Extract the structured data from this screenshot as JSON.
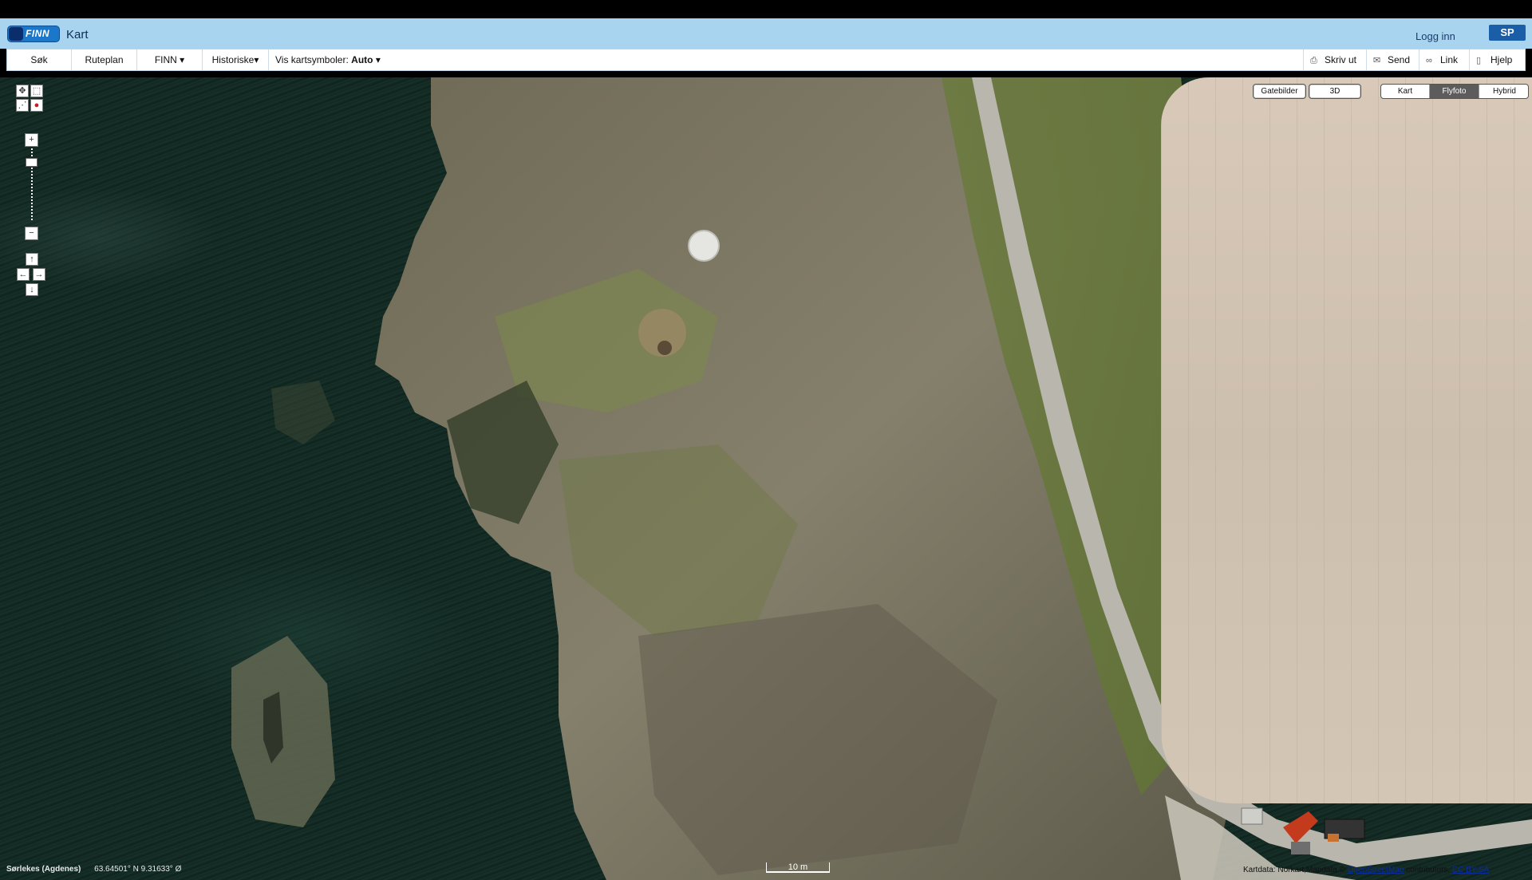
{
  "header": {
    "logo_text": "FINN",
    "app_title": "Kart",
    "login_label": "Logg inn",
    "brand_badge": "SP"
  },
  "toolbar": {
    "items": [
      {
        "label": "Søk"
      },
      {
        "label": "Ruteplan"
      },
      {
        "label": "FINN ▾"
      },
      {
        "label": "Historiske▾"
      }
    ],
    "symbols_prefix": "Vis kartsymboler:",
    "symbols_value": "Auto ▾",
    "actions": [
      {
        "label": "Skriv ut",
        "icon": "printer-icon"
      },
      {
        "label": "Send",
        "icon": "mail-icon"
      },
      {
        "label": "Link",
        "icon": "link-icon"
      },
      {
        "label": "Hjelp",
        "icon": "help-icon"
      }
    ]
  },
  "map": {
    "view_buttons": [
      "Gatebilder",
      "3D"
    ],
    "map_types": [
      {
        "label": "Kart",
        "active": false
      },
      {
        "label": "Flyfoto",
        "active": true
      },
      {
        "label": "Hybrid",
        "active": false
      }
    ],
    "zoom_in": "+",
    "zoom_out": "−",
    "pan": {
      "up": "↑",
      "left": "←",
      "right": "→",
      "down": "↓"
    },
    "location_label": "Sørlekes (Agdenes)",
    "coords": "63.64501° N  9.31633° Ø",
    "scale_label": "10 m",
    "attribution_prefix": "Kartdata: Norkart,Mapdata ©",
    "attribution_link": "OpenStreetMap",
    "attribution_middle": "contributors,",
    "attribution_license": "CC BY-SA"
  },
  "colors": {
    "header_bg": "#a9d4ef",
    "sea": "#13261f",
    "active_segment": "#5c5c5c"
  }
}
